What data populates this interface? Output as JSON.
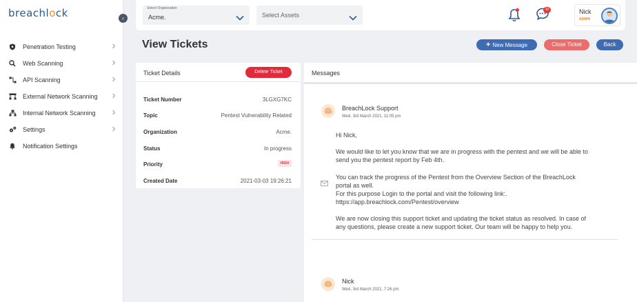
{
  "brand": {
    "prefix": "breachl",
    "accent": "o",
    "suffix": "ck"
  },
  "sidebar": {
    "items": [
      {
        "label": "Penetration Testing",
        "icon": "shield-icon"
      },
      {
        "label": "Web Scanning",
        "icon": "search-icon"
      },
      {
        "label": "API Scanning",
        "icon": "api-icon"
      },
      {
        "label": "External Network Scanning",
        "icon": "network-icon"
      },
      {
        "label": "Internal Network Scanning",
        "icon": "sitemap-icon"
      },
      {
        "label": "Settings",
        "icon": "gears-icon"
      },
      {
        "label": "Notification Settings",
        "icon": "bell-icon"
      }
    ],
    "collapse_glyph": "‹"
  },
  "topbar": {
    "org_label": "Select Organization",
    "org_value": "Acme.",
    "assets_placeholder": "Select Assets",
    "chat_count": "10",
    "user_name": "Nick",
    "user_role": "ADMIN"
  },
  "page": {
    "title": "View Tickets",
    "new_message_label": "New Message",
    "close_ticket_label": "Close Ticket",
    "back_label": "Back"
  },
  "details": {
    "title": "Ticket Details",
    "delete_label": "Delete Ticket",
    "rows": [
      {
        "label": "Ticket Number",
        "value": "3LGXG7KC"
      },
      {
        "label": "Topic",
        "value": "Pentest Vulnerability Related"
      },
      {
        "label": "Organization",
        "value": "Acme."
      },
      {
        "label": "Status",
        "value": "In progress"
      },
      {
        "label": "Priority",
        "value": "HIGH"
      },
      {
        "label": "Created Date",
        "value": "2021-03-03 19:26:21"
      }
    ]
  },
  "messages": {
    "title": "Messages",
    "items": [
      {
        "author": "BreachLock Support",
        "date": "Wed, 3rd March 2021, 11:05 pm",
        "lines": [
          "Hi Nick,",
          "",
          "We would like to let you know that we are in progress with the pentest and we will be able to",
          "send you the pentest report by Feb 4th.",
          "",
          "You can track the progress of the Pentest from the Overview Section of the BreachLock",
          "portal as well.",
          "For this purpose Login to the portal and visit the following link:.",
          "https://app.breachlock.com/Pentest/overview",
          "",
          "We are now closing this support ticket and updating the ticket status as resolved. In case of",
          "any questions, please create a new support ticket. Our team will be happy to help you."
        ]
      },
      {
        "author": "Nick",
        "date": "Wed, 3rd March 2021, 7:26 pm",
        "lines": []
      }
    ]
  },
  "colors": {
    "brand_blue": "#2b5a8c",
    "brand_orange": "#f08a2c",
    "primary_button": "#3f6bb3",
    "danger": "#e02b3b",
    "close_button": "#ec6b6b"
  }
}
